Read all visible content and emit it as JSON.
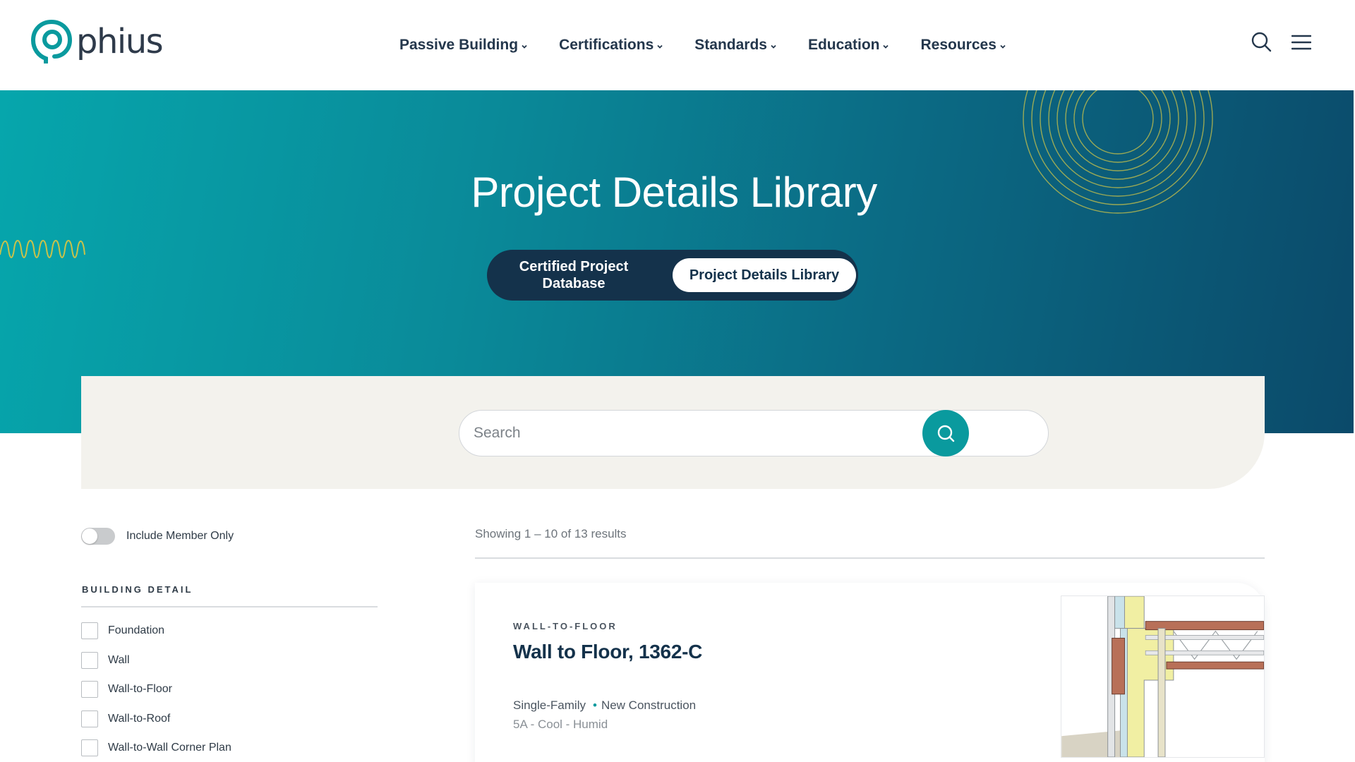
{
  "brand": {
    "name": "phius",
    "color": "#0a9a9e"
  },
  "nav": {
    "items": [
      {
        "label": "Passive Building"
      },
      {
        "label": "Certifications"
      },
      {
        "label": "Standards"
      },
      {
        "label": "Education"
      },
      {
        "label": "Resources"
      }
    ],
    "icons": [
      "search-icon",
      "hamburger-menu-icon"
    ]
  },
  "hero": {
    "title": "Project Details Library",
    "toggle": {
      "left_label": "Certified Project Database",
      "right_label": "Project Details Library",
      "selected": "right"
    }
  },
  "search": {
    "placeholder": "Search",
    "value": ""
  },
  "filters": {
    "member_toggle_label": "Include Member Only",
    "member_toggle_on": false,
    "section_title": "BUILDING DETAIL",
    "options": [
      {
        "label": "Foundation",
        "checked": false
      },
      {
        "label": "Wall",
        "checked": false
      },
      {
        "label": "Wall-to-Floor",
        "checked": false
      },
      {
        "label": "Wall-to-Roof",
        "checked": false
      },
      {
        "label": "Wall-to-Wall Corner Plan",
        "checked": false
      }
    ]
  },
  "results": {
    "count_text": "Showing 1 – 10 of 13 results",
    "cards": [
      {
        "category": "WALL-TO-FLOOR",
        "title": "Wall to Floor, 1362-C",
        "building_type": "Single-Family",
        "project_type": "New Construction",
        "climate": "5A - Cool - Humid"
      }
    ]
  },
  "colors": {
    "accent": "#0a9a9e",
    "navy": "#14324b",
    "panel_bg": "#f3f2ed",
    "hero_start": "#06a6ac",
    "hero_end": "#0b4a6a",
    "decor_gold": "#c9c24a"
  }
}
